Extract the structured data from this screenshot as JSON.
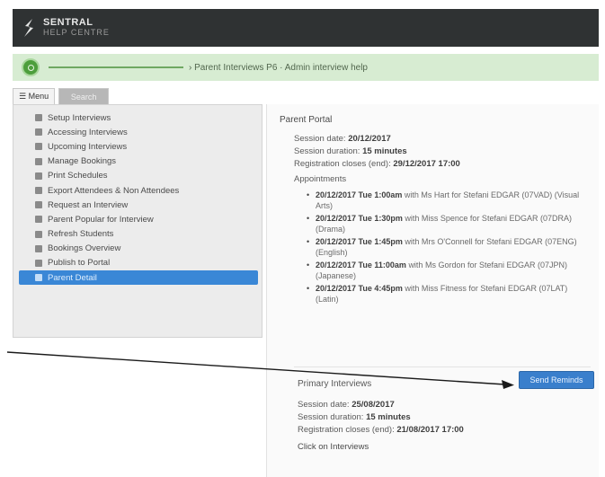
{
  "header": {
    "brand_name": "SENTRAL",
    "brand_sub": "HELP CENTRE"
  },
  "breadcrumb": {
    "text": "› Parent Interviews P6 · Admin interview help"
  },
  "tabs": [
    {
      "label": "☰ Menu"
    },
    {
      "label": "Search"
    }
  ],
  "sidebar": {
    "items": [
      {
        "label": "Setup Interviews"
      },
      {
        "label": "Accessing Interviews"
      },
      {
        "label": "Upcoming Interviews"
      },
      {
        "label": "Manage Bookings"
      },
      {
        "label": "Print Schedules"
      },
      {
        "label": "Export Attendees & Non Attendees"
      },
      {
        "label": "Request an Interview"
      },
      {
        "label": "Parent Popular for Interview"
      },
      {
        "label": "Refresh Students"
      },
      {
        "label": "Bookings Overview"
      },
      {
        "label": "Publish to Portal"
      },
      {
        "label": "Parent Detail"
      }
    ]
  },
  "main": {
    "portal_title": "Parent Portal",
    "session1": {
      "date_label": "Session date:",
      "date_value": "20/12/2017",
      "duration_label": "Session duration:",
      "duration_value": "15 minutes",
      "closes_label": "Registration closes (end):",
      "closes_value": "29/12/2017 17:00"
    },
    "appointments_heading": "Appointments",
    "appointments": [
      {
        "time": "20/12/2017 Tue 1:00am",
        "rest": "with Ms Hart for Stefani EDGAR (07VAD) (Visual Arts)"
      },
      {
        "time": "20/12/2017 Tue 1:30pm",
        "rest": "with Miss Spence for Stefani EDGAR (07DRA) (Drama)"
      },
      {
        "time": "20/12/2017 Tue 1:45pm",
        "rest": "with Mrs O'Connell for Stefani EDGAR (07ENG) (English)"
      },
      {
        "time": "20/12/2017 Tue 11:00am",
        "rest": "with Ms Gordon for Stefani EDGAR (07JPN) (Japanese)"
      },
      {
        "time": "20/12/2017 Tue 4:45pm",
        "rest": "with Miss Fitness for Stefani EDGAR (07LAT) (Latin)"
      }
    ],
    "primary_title": "Primary Interviews",
    "send_button": "Send Reminds",
    "session2": {
      "date_label": "Session date:",
      "date_value": "25/08/2017",
      "duration_label": "Session duration:",
      "duration_value": "15 minutes",
      "closes_label": "Registration closes (end):",
      "closes_value": "21/08/2017 17:00"
    },
    "click_title": "Click on Interviews"
  }
}
